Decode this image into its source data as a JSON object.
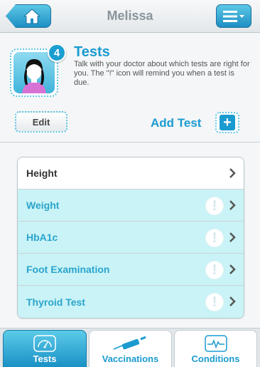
{
  "header": {
    "title": "Melissa",
    "home_icon": "home-icon",
    "menu_icon": "menu-list-icon"
  },
  "section": {
    "title": "Tests",
    "badge_count": "4",
    "description": "Talk with your doctor about which tests are right for you. The \"!\" icon will remind you when a test is due.",
    "avatar_icon": "girl-avatar-icon"
  },
  "actions": {
    "edit_label": "Edit",
    "add_label": "Add Test",
    "add_icon": "plus-icon"
  },
  "tests": [
    {
      "label": "Height",
      "due": false
    },
    {
      "label": "Weight",
      "due": true,
      "alert": "!"
    },
    {
      "label": "HbA1c",
      "due": true,
      "alert": "!"
    },
    {
      "label": "Foot Examination",
      "due": true,
      "alert": "!"
    },
    {
      "label": "Thyroid Test",
      "due": true,
      "alert": "!"
    }
  ],
  "tabs": [
    {
      "label": "Tests",
      "icon": "gauge-icon",
      "active": true
    },
    {
      "label": "Vaccinations",
      "icon": "syringe-icon",
      "active": false
    },
    {
      "label": "Conditions",
      "icon": "heartbeat-icon",
      "active": false
    }
  ],
  "colors": {
    "accent": "#1a9bd0",
    "due_row": "#c9f3f6"
  }
}
